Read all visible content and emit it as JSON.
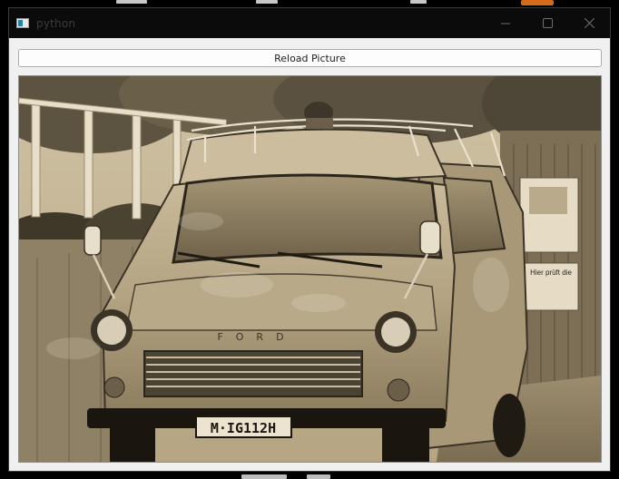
{
  "window": {
    "title": "python"
  },
  "toolbar": {
    "reload_label": "Reload Picture"
  },
  "picture": {
    "grille_brand": "FORD",
    "license_plate": "M·IG112H",
    "sign_text": "Hier prüft die",
    "palette": {
      "highlight": "#efe6d2",
      "midtone": "#a8987a",
      "shadow": "#3a3326",
      "deep": "#1a160f"
    }
  }
}
